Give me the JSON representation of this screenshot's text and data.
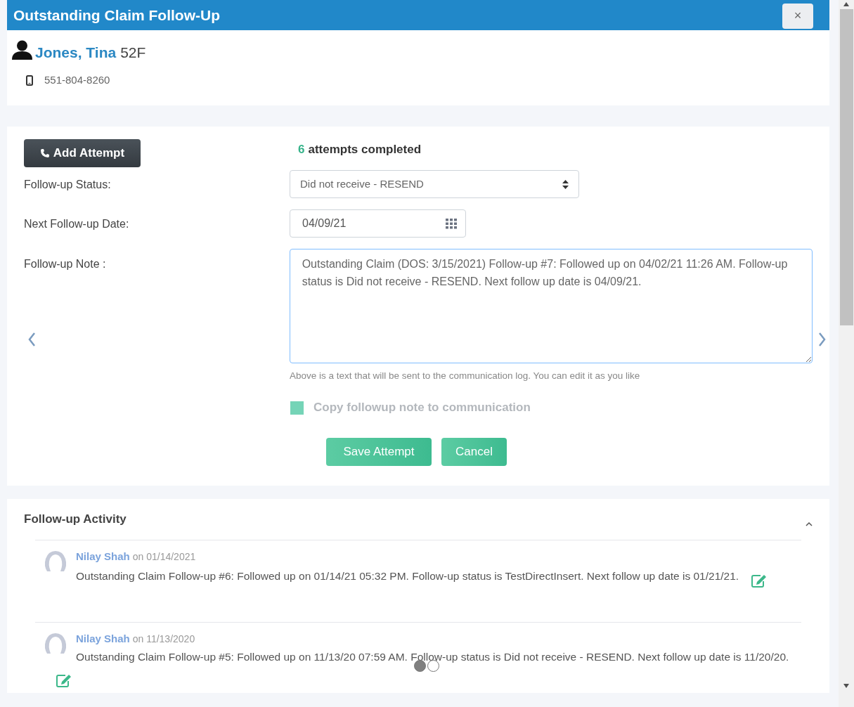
{
  "window": {
    "title": "Outstanding Claim Follow-Up",
    "close": "×"
  },
  "patient": {
    "name": "Jones, Tina",
    "age_sex": "52F",
    "phone": "551-804-8260"
  },
  "form": {
    "add_button": "Add Attempt",
    "attempts_count": "6",
    "attempts_label": "attempts completed",
    "fields": [
      {
        "kind": "select",
        "label": "Follow-up Status:",
        "value": "Did not receive - RESEND"
      },
      {
        "kind": "date",
        "label": "Next Follow-up Date:",
        "value": "04/09/21"
      },
      {
        "kind": "textarea",
        "label": "Follow-up Note :",
        "value": "Outstanding Claim (DOS: 3/15/2021) Follow-up #7: Followed up on 04/02/21 11:26 AM. Follow-up status is Did not receive - RESEND. Next follow up date is 04/09/21.\n\n"
      }
    ],
    "hint": "Above is a text that will be sent to the communication log. You can edit it as you like",
    "copy_checkbox": {
      "label": "Copy followup note to communication",
      "checked": true,
      "disabled": true
    },
    "buttons": [
      "Save Attempt",
      "Cancel"
    ]
  },
  "activity": {
    "title": "Follow-up Activity",
    "expanded": true,
    "entries": [
      {
        "author": "Nilay Shah",
        "date": "on 01/14/2021",
        "text": "Outstanding Claim Follow-up #6: Followed up on 01/14/21 05:32 PM. Follow-up status is TestDirectInsert. Next follow up date is 01/21/21."
      },
      {
        "author": "Nilay Shah",
        "date": "on 11/13/2020",
        "text": "Outstanding Claim Follow-up #5: Followed up on 11/13/20 07:59 AM. Follow-up status is Did not receive - RESEND. Next follow up date is 11/20/20."
      }
    ]
  },
  "pager": [
    {
      "selected": true
    },
    {
      "selected": false
    }
  ]
}
